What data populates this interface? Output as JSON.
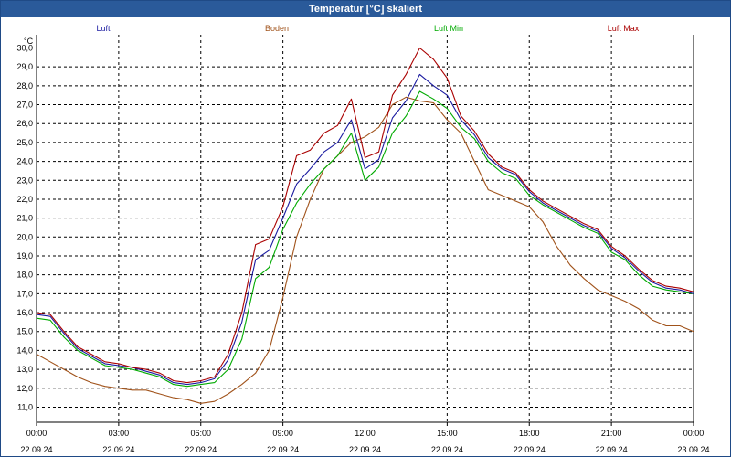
{
  "window": {
    "title": "Temperatur [°C] skaliert"
  },
  "colors": {
    "titlebar": "#2a5a9a",
    "grid": "#000000",
    "background": "#ffffff"
  },
  "chart_data": {
    "type": "line",
    "title": "Temperatur [°C] skaliert",
    "ylabel": "°C",
    "ylim": [
      10.2,
      30.7
    ],
    "yticks": [
      "11,0",
      "12,0",
      "13,0",
      "14,0",
      "15,0",
      "16,0",
      "17,0",
      "18,0",
      "19,0",
      "20,0",
      "21,0",
      "22,0",
      "23,0",
      "24,0",
      "25,0",
      "26,0",
      "27,0",
      "28,0",
      "29,0",
      "30,0"
    ],
    "x_tick_times": [
      "00:00",
      "03:00",
      "06:00",
      "09:00",
      "12:00",
      "15:00",
      "18:00",
      "21:00",
      "00:00"
    ],
    "x_tick_dates": [
      "22.09.24",
      "22.09.24",
      "22.09.24",
      "22.09.24",
      "22.09.24",
      "22.09.24",
      "22.09.24",
      "22.09.24",
      "23.09.24"
    ],
    "xlim_hours": [
      0,
      24
    ],
    "grid": true,
    "legend_position": "top",
    "series": [
      {
        "name": "Luft",
        "color": "#1a1aa0",
        "x": [
          0,
          0.5,
          1,
          1.5,
          2,
          2.5,
          3,
          3.5,
          4,
          4.5,
          5,
          5.5,
          6,
          6.5,
          7,
          7.5,
          8,
          8.5,
          9,
          9.5,
          10,
          10.5,
          11,
          11.5,
          12,
          12.5,
          13,
          13.5,
          14,
          14.5,
          15,
          15.5,
          16,
          16.5,
          17,
          17.5,
          18,
          18.5,
          19,
          19.5,
          20,
          20.5,
          21,
          21.5,
          22,
          22.5,
          23,
          23.5,
          24
        ],
        "values": [
          15.9,
          15.8,
          14.9,
          14.1,
          13.7,
          13.3,
          13.2,
          13.1,
          12.9,
          12.7,
          12.3,
          12.2,
          12.3,
          12.5,
          13.5,
          15.5,
          18.8,
          19.3,
          21.0,
          22.8,
          23.6,
          24.5,
          25.0,
          26.2,
          23.6,
          24.1,
          26.3,
          27.2,
          28.6,
          28.0,
          27.5,
          26.2,
          25.4,
          24.2,
          23.6,
          23.3,
          22.4,
          21.8,
          21.4,
          21.0,
          20.6,
          20.3,
          19.4,
          18.9,
          18.2,
          17.6,
          17.3,
          17.2,
          17.0
        ]
      },
      {
        "name": "Boden",
        "color": "#a0521a",
        "x": [
          0,
          0.5,
          1,
          1.5,
          2,
          2.5,
          3,
          3.5,
          4,
          4.5,
          5,
          5.5,
          6,
          6.5,
          7,
          7.5,
          8,
          8.5,
          9,
          9.5,
          10,
          10.5,
          11,
          11.5,
          12,
          12.5,
          13,
          13.5,
          14,
          14.5,
          15,
          15.5,
          16,
          16.5,
          17,
          17.5,
          18,
          18.5,
          19,
          19.5,
          20,
          20.5,
          21,
          21.5,
          22,
          22.5,
          23,
          23.5,
          24
        ],
        "values": [
          13.8,
          13.4,
          13.0,
          12.6,
          12.3,
          12.1,
          12.0,
          11.9,
          11.9,
          11.7,
          11.5,
          11.4,
          11.2,
          11.3,
          11.7,
          12.2,
          12.8,
          14.0,
          16.8,
          20.0,
          22.0,
          23.6,
          24.3,
          25.0,
          25.3,
          25.8,
          27.0,
          27.4,
          27.2,
          27.1,
          26.2,
          25.5,
          24.0,
          22.5,
          22.2,
          21.9,
          21.6,
          20.8,
          19.5,
          18.5,
          17.8,
          17.2,
          16.9,
          16.6,
          16.2,
          15.6,
          15.3,
          15.3,
          15.0
        ]
      },
      {
        "name": "Luft Min",
        "color": "#00aa00",
        "x": [
          0,
          0.5,
          1,
          1.5,
          2,
          2.5,
          3,
          3.5,
          4,
          4.5,
          5,
          5.5,
          6,
          6.5,
          7,
          7.5,
          8,
          8.5,
          9,
          9.5,
          10,
          10.5,
          11,
          11.5,
          12,
          12.5,
          13,
          13.5,
          14,
          14.5,
          15,
          15.5,
          16,
          16.5,
          17,
          17.5,
          18,
          18.5,
          19,
          19.5,
          20,
          20.5,
          21,
          21.5,
          22,
          22.5,
          23,
          23.5,
          24
        ],
        "values": [
          15.7,
          15.6,
          14.7,
          14.0,
          13.6,
          13.2,
          13.1,
          13.0,
          12.8,
          12.6,
          12.2,
          12.1,
          12.2,
          12.3,
          13.0,
          14.6,
          17.8,
          18.4,
          20.4,
          21.8,
          22.8,
          23.6,
          24.3,
          25.5,
          23.0,
          23.7,
          25.5,
          26.4,
          27.7,
          27.3,
          26.8,
          25.8,
          25.2,
          24.0,
          23.4,
          23.1,
          22.2,
          21.7,
          21.3,
          20.9,
          20.5,
          20.2,
          19.2,
          18.8,
          18.0,
          17.4,
          17.2,
          17.1,
          17.0
        ]
      },
      {
        "name": "Luft Max",
        "color": "#aa0000",
        "x": [
          0,
          0.5,
          1,
          1.5,
          2,
          2.5,
          3,
          3.5,
          4,
          4.5,
          5,
          5.5,
          6,
          6.5,
          7,
          7.5,
          8,
          8.5,
          9,
          9.5,
          10,
          10.5,
          11,
          11.5,
          12,
          12.5,
          13,
          13.5,
          14,
          14.5,
          15,
          15.5,
          16,
          16.5,
          17,
          17.5,
          18,
          18.5,
          19,
          19.5,
          20,
          20.5,
          21,
          21.5,
          22,
          22.5,
          23,
          23.5,
          24
        ],
        "values": [
          16.0,
          15.9,
          15.0,
          14.2,
          13.8,
          13.4,
          13.3,
          13.1,
          13.0,
          12.8,
          12.4,
          12.3,
          12.4,
          12.6,
          13.8,
          16.0,
          19.6,
          19.9,
          21.6,
          24.3,
          24.6,
          25.5,
          25.9,
          27.3,
          24.2,
          24.5,
          27.5,
          28.6,
          30.0,
          29.4,
          28.4,
          26.4,
          25.6,
          24.4,
          23.7,
          23.4,
          22.5,
          21.9,
          21.5,
          21.1,
          20.7,
          20.4,
          19.5,
          19.0,
          18.3,
          17.7,
          17.4,
          17.3,
          17.1
        ]
      }
    ]
  }
}
